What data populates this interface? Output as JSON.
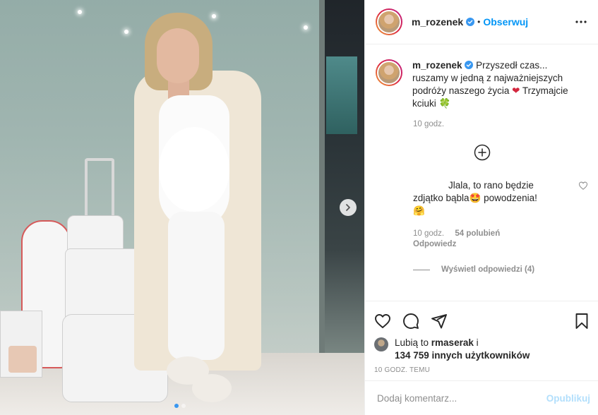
{
  "post": {
    "username": "m_rozenek",
    "follow_label": "Obserwuj",
    "separator": "•"
  },
  "caption": {
    "username": "m_rozenek",
    "text": "Przyszedł czas... ruszamy w jedną z najważniejszych podróży naszego życia",
    "heart_emoji": "❤",
    "text2": " Trzymajcie kciuki ",
    "clover_emoji": "🍀",
    "time": "10 godz."
  },
  "reply": {
    "line1": "Jlala, to rano będzie",
    "line2": "zdjątko bąbla",
    "star_emoji": "🤩",
    "line3": " powodzenia!",
    "hug_emoji": "🤗",
    "time": "10 godz.",
    "likes": "54 polubień",
    "reply_label": "Odpowiedz",
    "view_replies": "Wyświetl odpowiedzi (4)"
  },
  "likes": {
    "prefix": "Lubią to ",
    "user": "rmaserak",
    "suffix": " i",
    "count": "134 759 innych użytkowników"
  },
  "timestamp": "10 GODZ. TEMU",
  "comment_box": {
    "placeholder": "Dodaj komentarz...",
    "publish_label": "Opublikuj"
  },
  "colors": {
    "accent": "#0095f6",
    "publish_disabled": "#b2dffc",
    "muted": "#8e8e8e",
    "text": "#262626"
  },
  "icons": [
    "more-options-icon",
    "verified-icon",
    "add-comment-icon",
    "like-icon",
    "comment-icon",
    "share-icon",
    "save-icon",
    "next-arrow-icon"
  ]
}
